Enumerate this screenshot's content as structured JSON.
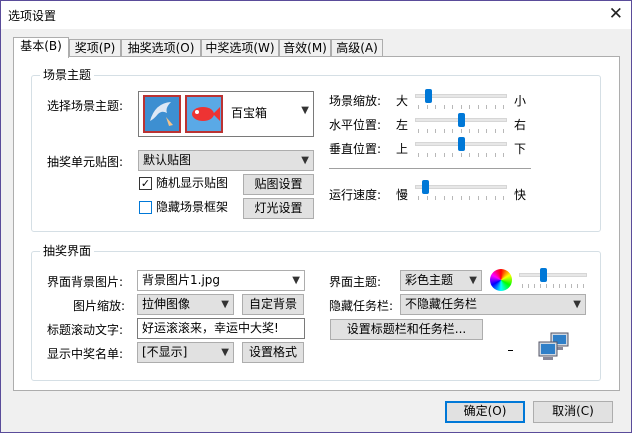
{
  "window": {
    "title": "选项设置",
    "close_glyph": "✕"
  },
  "tabs": [
    {
      "label": "基本(B)",
      "active": true
    },
    {
      "label": "奖项(P)"
    },
    {
      "label": "抽奖选项(O)"
    },
    {
      "label": "中奖选项(W)"
    },
    {
      "label": "音效(M)"
    },
    {
      "label": "高级(A)"
    }
  ],
  "scene": {
    "group_label": "场景主题",
    "select_label": "选择场景主题:",
    "theme_value": "百宝箱",
    "cell_label": "抽奖单元贴图:",
    "cell_value": "默认贴图",
    "random_label": "随机显示贴图",
    "random_checked": true,
    "random_mark": "✓",
    "hide_frame_label": "隐藏场景框架",
    "hide_frame_checked": false,
    "texture_btn": "贴图设置",
    "light_btn": "灯光设置",
    "zoom": {
      "label": "场景缩放:",
      "left": "大",
      "right": "小",
      "level": 0.12
    },
    "hpos": {
      "label": "水平位置:",
      "left": "左",
      "right": "右",
      "level": 0.5
    },
    "vpos": {
      "label": "垂直位置:",
      "left": "上",
      "right": "下",
      "level": 0.5
    },
    "speed": {
      "label": "运行速度:",
      "left": "慢",
      "right": "快",
      "level": 0.08
    }
  },
  "ui": {
    "group_label": "抽奖界面",
    "bg_label": "界面背景图片:",
    "bg_value": "背景图片1.jpg",
    "scale_label": "图片缩放:",
    "scale_value": "拉伸图像",
    "custom_bg_btn": "自定背景",
    "scroll_label": "标题滚动文字:",
    "scroll_value": "好运滚滚来，幸运中大奖!",
    "winner_label": "显示中奖名单:",
    "winner_value": "[不显示]",
    "format_btn": "设置格式",
    "theme_label": "界面主题:",
    "theme_value": "彩色主题",
    "theme_level": 0.35,
    "taskbar_label": "隐藏任务栏:",
    "taskbar_value": "不隐藏任务栏",
    "title_taskbar_btn": "设置标题栏和任务栏..."
  },
  "footer": {
    "ok": "确定(O)",
    "cancel": "取消(C)"
  },
  "colors": {
    "accent": "#0078d7",
    "border": "#adadad",
    "face": "#f0f0f0",
    "button": "#e1e1e1"
  }
}
